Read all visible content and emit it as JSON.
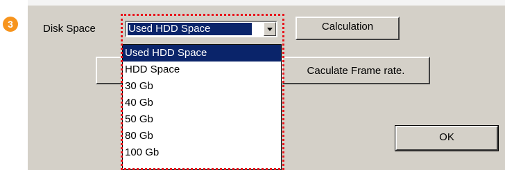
{
  "step_badge": "3",
  "disk_space": {
    "label": "Disk Space",
    "selected_value": "Used HDD Space",
    "options": [
      "Used HDD Space",
      "HDD Space",
      "30 Gb",
      "40 Gb",
      "50 Gb",
      "80 Gb",
      "100 Gb"
    ]
  },
  "buttons": {
    "calculation": "Calculation",
    "calculate_frame_rate": "Caculate Frame rate.",
    "ok": "OK"
  },
  "colors": {
    "badge": "#f7941d",
    "highlight_frame": "#e8141b",
    "selection": "#0a246a",
    "dialog_bg": "#d4d0c8"
  }
}
